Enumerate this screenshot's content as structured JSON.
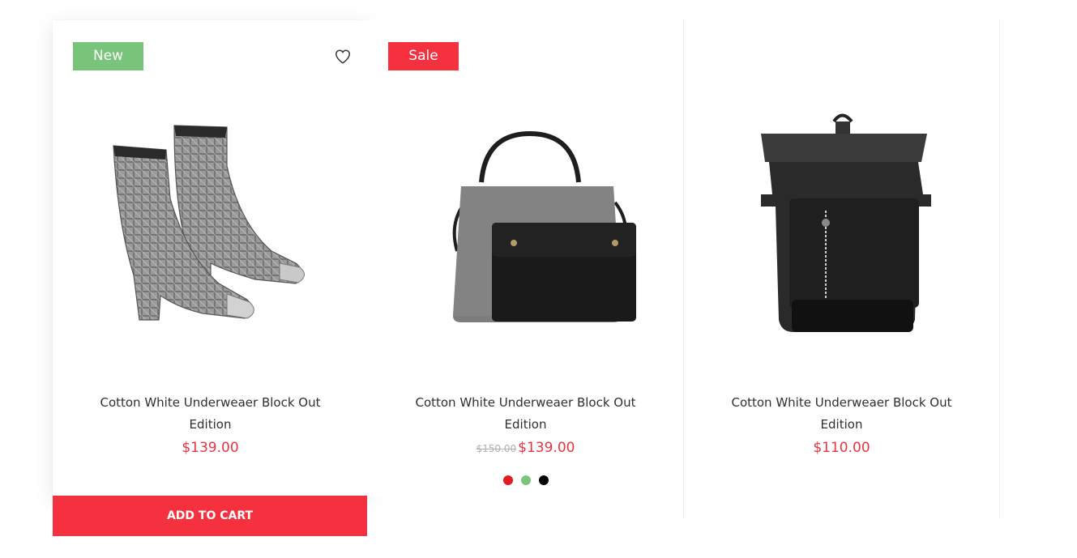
{
  "products": [
    {
      "badge": "New",
      "title": "Cotton White Underweaer Block Out Edition",
      "price": "$139.00",
      "image_icon": "ankle-boots-image",
      "wishlist_icon": "heart-outline-icon"
    },
    {
      "badge": "Sale",
      "title": "Cotton White Underweaer Block Out Edition",
      "old_price": "$150.00",
      "price": "$139.00",
      "image_icon": "felt-handbag-image",
      "swatches": [
        "#e31b23",
        "#7ac47b",
        "#000000"
      ]
    },
    {
      "title": "Cotton White Underweaer Block Out Edition",
      "price": "$110.00",
      "image_icon": "leather-backpack-image"
    }
  ],
  "cart_button_label": "ADD TO CART",
  "colors": {
    "accent": "#f5303f",
    "new_badge": "#78c47a",
    "price": "#e8343f"
  }
}
